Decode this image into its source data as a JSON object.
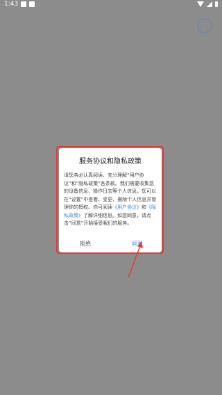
{
  "status_bar": {
    "time": "1:43"
  },
  "dialog": {
    "title": "服务协议和隐私政策",
    "body_part1": "请您务必认真阅读、充分理解“用户协议”和“隐私政策”各条款。我们需要收集您的设备信息、操作日志等个人信息。您可以在“设置”中查看、变更、删除个人信息并管理你的授权。你可阅读",
    "link_user_agreement": "《用户协议》",
    "and_text": "和",
    "link_privacy": "《隐私政策》",
    "body_part2": "了解详细信息。如您同意，请点击“同意”开始接受我们的服务。",
    "reject_label": "拒绝",
    "agree_label": "同意"
  },
  "colors": {
    "overlay": "#8c8c8c",
    "highlight": "#e53a3a",
    "link": "#3b8fe0"
  }
}
